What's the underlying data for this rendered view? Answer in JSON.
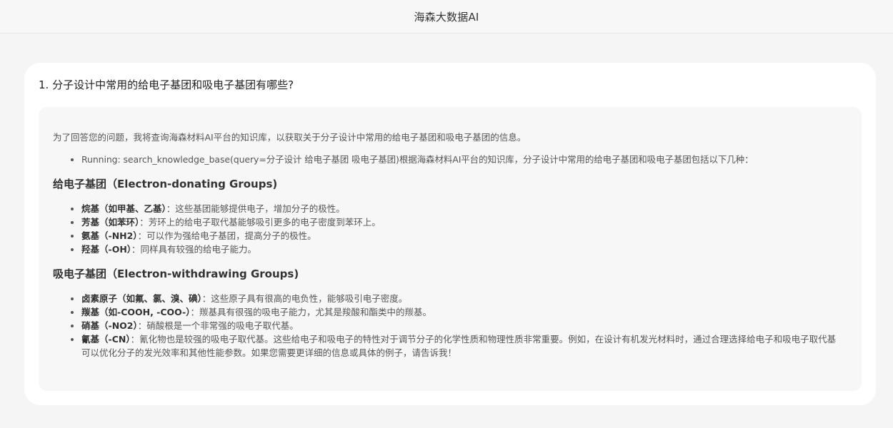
{
  "header": {
    "title": "海森大数据AI"
  },
  "question": {
    "text": "1. 分子设计中常用的给电子基团和吸电子基团有哪些?"
  },
  "answer": {
    "intro": "为了回答您的问题，我将查询海森材料AI平台的知识库，以获取关于分子设计中常用的给电子基团和吸电子基团的信息。",
    "tool_call": "Running: search_knowledge_base(query=分子设计 给电子基团 吸电子基团)根据海森材料AI平台的知识库，分子设计中常用的给电子基团和吸电子基团包括以下几种：",
    "sections": [
      {
        "heading": "给电子基团（Electron-donating Groups)",
        "items": [
          {
            "term": "烷基（如甲基、乙基）",
            "desc": "：这些基团能够提供电子，增加分子的极性。"
          },
          {
            "term": "芳基（如苯环）",
            "desc": "：芳环上的给电子取代基能够吸引更多的电子密度到苯环上。"
          },
          {
            "term": "氨基（-NH2）",
            "desc": "：可以作为强给电子基团，提高分子的极性。"
          },
          {
            "term": "羟基（-OH）",
            "desc": "：同样具有较强的给电子能力。"
          }
        ]
      },
      {
        "heading": "吸电子基团（Electron-withdrawing Groups)",
        "items": [
          {
            "term": "卤素原子（如氟、氯、溴、碘）",
            "desc": "：这些原子具有很高的电负性，能够吸引电子密度。"
          },
          {
            "term": "羰基（如-COOH, -COO-）",
            "desc": "：羰基具有很强的吸电子能力，尤其是羧酸和酯类中的羰基。"
          },
          {
            "term": "硝基（-NO2）",
            "desc": "：硝酸根是一个非常强的吸电子取代基。"
          },
          {
            "term": "氰基（-CN）",
            "desc": "：氰化物也是较强的吸电子取代基。这些给电子和吸电子的特性对于调节分子的化学性质和物理性质非常重要。例如，在设计有机发光材料时，通过合理选择给电子和吸电子取代基可以优化分子的发光效率和其他性能参数。如果您需要更详细的信息或具体的例子，请告诉我！"
          }
        ]
      }
    ]
  }
}
